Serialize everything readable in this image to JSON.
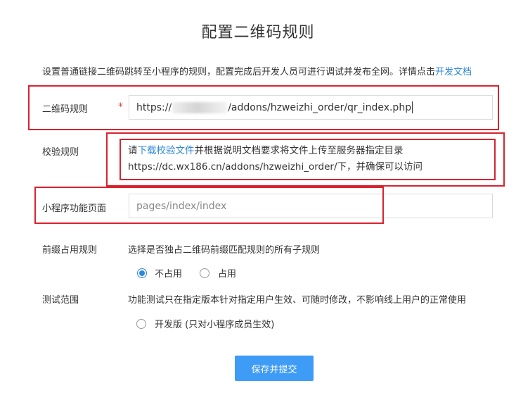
{
  "page": {
    "title": "配置二维码规则",
    "description": "设置普通链接二维码跳转至小程序的规则，配置完成后开发人员可进行调试并发布全网。详情点击",
    "description_link": "开发文档"
  },
  "qr_rule": {
    "label": "二维码规则",
    "required_mark": "*",
    "value_prefix": "https://",
    "value_suffix": "/addons/hzweizhi_order/qr_index.php"
  },
  "verify_rule": {
    "label": "校验规则",
    "text_before": "请",
    "link": "下载校验文件",
    "text_after": "并根据说明文档要求将文件上传至服务器指定目录https://dc.wx186.cn/addons/hzweizhi_order/下，并确保可以访问"
  },
  "function_page": {
    "label": "小程序功能页面",
    "placeholder": "pages/index/index"
  },
  "prefix_rule": {
    "label": "前缀占用规则",
    "hint": "选择是否独占二维码前缀匹配规则的所有子规则",
    "options": [
      {
        "label": "不占用",
        "checked": true
      },
      {
        "label": "占用",
        "checked": false
      }
    ]
  },
  "test_scope": {
    "label": "测试范围",
    "hint": "功能测试只在指定版本针对指定用户生效、可随时修改，不影响线上用户的正常使用",
    "option": {
      "label": "开发版 (只对小程序成员生效)",
      "checked": false
    }
  },
  "submit": {
    "label": "保存并提交"
  },
  "colors": {
    "primary": "#3e9bf6",
    "link": "#2f88d8",
    "highlight": "#d9232e",
    "required": "#e64340"
  }
}
